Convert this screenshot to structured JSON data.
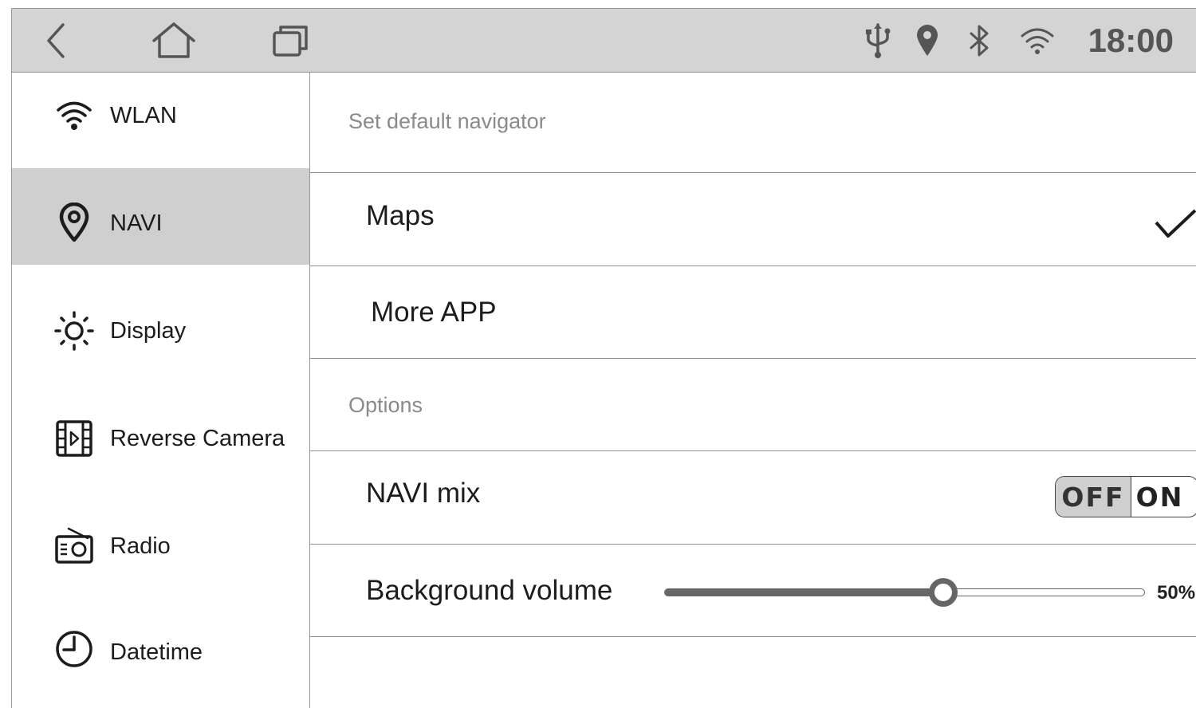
{
  "statusbar": {
    "time": "18:00",
    "nav_icons": [
      "back-icon",
      "home-icon",
      "recent-apps-icon"
    ],
    "status_icons": [
      "usb-icon",
      "location-icon",
      "bluetooth-icon",
      "wifi-icon"
    ]
  },
  "sidebar": {
    "items": [
      {
        "label": "WLAN",
        "icon": "wifi-icon"
      },
      {
        "label": "NAVI",
        "icon": "location-pin-icon",
        "active": true
      },
      {
        "label": "Display",
        "icon": "brightness-icon"
      },
      {
        "label": "Reverse Camera",
        "icon": "film-play-icon"
      },
      {
        "label": "Radio",
        "icon": "radio-icon"
      },
      {
        "label": "Datetime",
        "icon": "clock-icon"
      }
    ]
  },
  "main": {
    "navigator_section_title": "Set default navigator",
    "navigators": [
      {
        "label": "Maps",
        "selected": true
      },
      {
        "label": "More APP",
        "selected": false
      }
    ],
    "options_section_title": "Options",
    "navi_mix": {
      "label": "NAVI mix",
      "off_label": "OFF",
      "on_label": "ON",
      "state": "OFF"
    },
    "background_volume": {
      "label": "Background volume",
      "value_percent": 50,
      "value_text": "50%"
    }
  },
  "colors": {
    "statusbar_bg": "#d4d4d4",
    "active_item_bg": "#cfcfcf",
    "divider": "#8f8f8f",
    "section_title": "#8a8a8a",
    "slider": "#666666"
  }
}
